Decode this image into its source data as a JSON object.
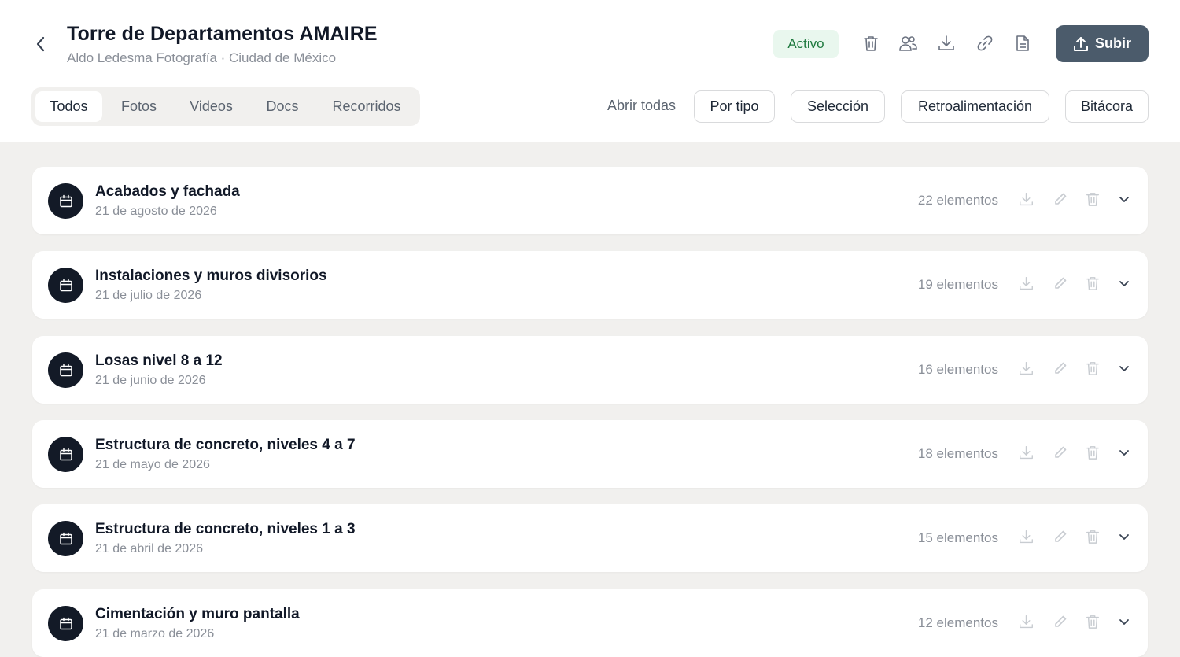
{
  "header": {
    "title": "Torre de Departamentos AMAIRE",
    "subtitle": "Aldo Ledesma Fotografía · Ciudad de México",
    "status": "Activo",
    "upload_label": "Subir",
    "icons": [
      "chevron-left-icon",
      "trash-icon",
      "users-icon",
      "download-icon",
      "link-icon",
      "document-icon",
      "upload-icon"
    ]
  },
  "tabs": [
    {
      "label": "Todos",
      "active": true
    },
    {
      "label": "Fotos",
      "active": false
    },
    {
      "label": "Videos",
      "active": false
    },
    {
      "label": "Docs",
      "active": false
    },
    {
      "label": "Recorridos",
      "active": false
    }
  ],
  "toolbar": {
    "open_all": "Abrir todas",
    "by_type": "Por tipo",
    "selection": "Selección",
    "feedback": "Retroalimentación",
    "log": "Bitácora"
  },
  "sessions": [
    {
      "title": "Acabados y fachada",
      "date": "21 de agosto de 2026",
      "count": "22 elementos"
    },
    {
      "title": "Instalaciones y muros divisorios",
      "date": "21 de julio de 2026",
      "count": "19 elementos"
    },
    {
      "title": "Losas nivel 8 a 12",
      "date": "21 de junio de 2026",
      "count": "16 elementos"
    },
    {
      "title": "Estructura de concreto, niveles 4 a 7",
      "date": "21 de mayo de 2026",
      "count": "18 elementos"
    },
    {
      "title": "Estructura de concreto, niveles 1 a 3",
      "date": "21 de abril de 2026",
      "count": "15 elementos"
    },
    {
      "title": "Cimentación y muro pantalla",
      "date": "21 de marzo de 2026",
      "count": "12 elementos"
    }
  ],
  "colors": {
    "accent": "#4b5b6b",
    "status_bg": "#e9f7ee",
    "status_text": "#1f7a3f",
    "page_bg": "#f1f0ee",
    "session_icon_bg": "#131a27"
  }
}
